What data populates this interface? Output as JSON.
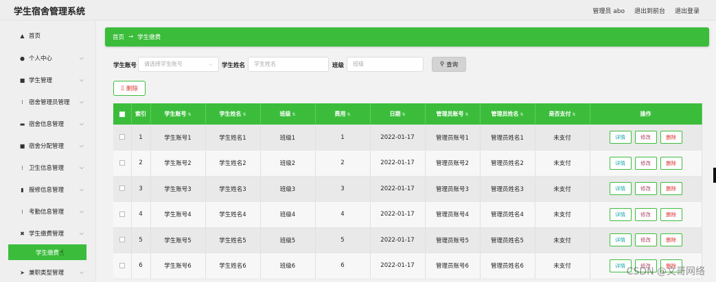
{
  "app": {
    "title": "学生宿舍管理系统",
    "top_links": [
      "管理员 abo",
      "退出到前台",
      "退出登录"
    ]
  },
  "sidebar": {
    "items": [
      {
        "label": "首页",
        "icon": "home-icon",
        "glyph": "▲",
        "has_chevron": false
      },
      {
        "label": "个人中心",
        "icon": "user-icon",
        "glyph": "●",
        "has_chevron": true
      },
      {
        "label": "学生管理",
        "icon": "student-icon",
        "glyph": "■",
        "has_chevron": true
      },
      {
        "label": "宿舍管理员管理",
        "icon": "grid-icon",
        "glyph": "⁞",
        "has_chevron": true
      },
      {
        "label": "宿舍信息管理",
        "icon": "building-icon",
        "glyph": "▬",
        "has_chevron": true
      },
      {
        "label": "宿舍分配管理",
        "icon": "assign-icon",
        "glyph": "■",
        "has_chevron": true
      },
      {
        "label": "卫生信息管理",
        "icon": "grid-icon",
        "glyph": "⁞",
        "has_chevron": true
      },
      {
        "label": "报修信息管理",
        "icon": "bar-chart-icon",
        "glyph": "▮",
        "has_chevron": true
      },
      {
        "label": "考勤信息管理",
        "icon": "grid-icon",
        "glyph": "⁞",
        "has_chevron": true
      },
      {
        "label": "学生缴费管理",
        "icon": "tools-icon",
        "glyph": "✖",
        "has_chevron": true
      },
      {
        "label": "兼职类型管理",
        "icon": "send-icon",
        "glyph": "➤",
        "has_chevron": true
      }
    ],
    "active_sub": "学生缴费"
  },
  "breadcrumb": {
    "home": "首页",
    "separator": "→",
    "current": "学生缴费"
  },
  "search": {
    "account_label": "学生账号",
    "account_placeholder": "请选择学生账号",
    "name_label": "学生姓名",
    "name_placeholder": "学生姓名",
    "class_label": "班级",
    "class_placeholder": "班级",
    "query_label": "查询"
  },
  "batch_delete_label": "删除",
  "table": {
    "headers": [
      "索引",
      "学生账号",
      "学生姓名",
      "班级",
      "费用",
      "日期",
      "管理员账号",
      "管理员姓名",
      "是否支付",
      "操作"
    ],
    "rows": [
      [
        "1",
        "学生账号1",
        "学生姓名1",
        "班级1",
        "1",
        "2022-01-17",
        "管理员账号1",
        "管理员姓名1",
        "未支付"
      ],
      [
        "2",
        "学生账号2",
        "学生姓名2",
        "班级2",
        "2",
        "2022-01-17",
        "管理员账号2",
        "管理员姓名2",
        "未支付"
      ],
      [
        "3",
        "学生账号3",
        "学生姓名3",
        "班级3",
        "3",
        "2022-01-17",
        "管理员账号3",
        "管理员姓名3",
        "未支付"
      ],
      [
        "4",
        "学生账号4",
        "学生姓名4",
        "班级4",
        "4",
        "2022-01-17",
        "管理员账号4",
        "管理员姓名4",
        "未支付"
      ],
      [
        "5",
        "学生账号5",
        "学生姓名5",
        "班级5",
        "5",
        "2022-01-17",
        "管理员账号5",
        "管理员姓名5",
        "未支付"
      ],
      [
        "6",
        "学生账号6",
        "学生姓名6",
        "班级6",
        "6",
        "2022-01-17",
        "管理员账号6",
        "管理员姓名6",
        "未支付"
      ]
    ],
    "row_actions": {
      "detail": "详情",
      "edit": "修改",
      "delete": "删除"
    }
  },
  "watermark": "CSDN @文哥网络",
  "colors": {
    "accent": "#3bbd3b",
    "danger": "#dd3333"
  }
}
